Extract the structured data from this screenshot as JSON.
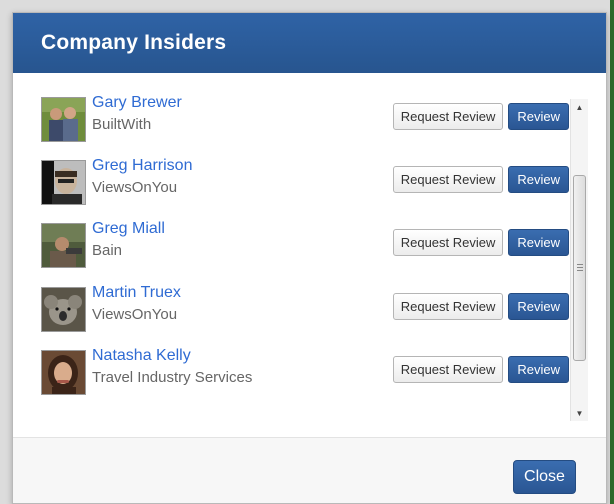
{
  "dialog": {
    "title": "Company Insiders",
    "close_label": "Close"
  },
  "insiders": [
    {
      "name": "Gary Brewer",
      "company": "BuiltWith",
      "request_label": "Request Review",
      "review_label": "Review"
    },
    {
      "name": "Greg Harrison",
      "company": "ViewsOnYou",
      "request_label": "Request Review",
      "review_label": "Review"
    },
    {
      "name": "Greg Miall",
      "company": "Bain",
      "request_label": "Request Review",
      "review_label": "Review"
    },
    {
      "name": "Martin Truex",
      "company": "ViewsOnYou",
      "request_label": "Request Review",
      "review_label": "Review"
    },
    {
      "name": "Natasha Kelly",
      "company": "Travel Industry Services",
      "request_label": "Request Review",
      "review_label": "Review"
    }
  ],
  "colors": {
    "header": "#2b5c9e",
    "link": "#2f6bd3",
    "primary_button": "#2a5693"
  },
  "icons": {
    "scroll_up": "chevron-up-icon",
    "scroll_down": "chevron-down-icon"
  }
}
